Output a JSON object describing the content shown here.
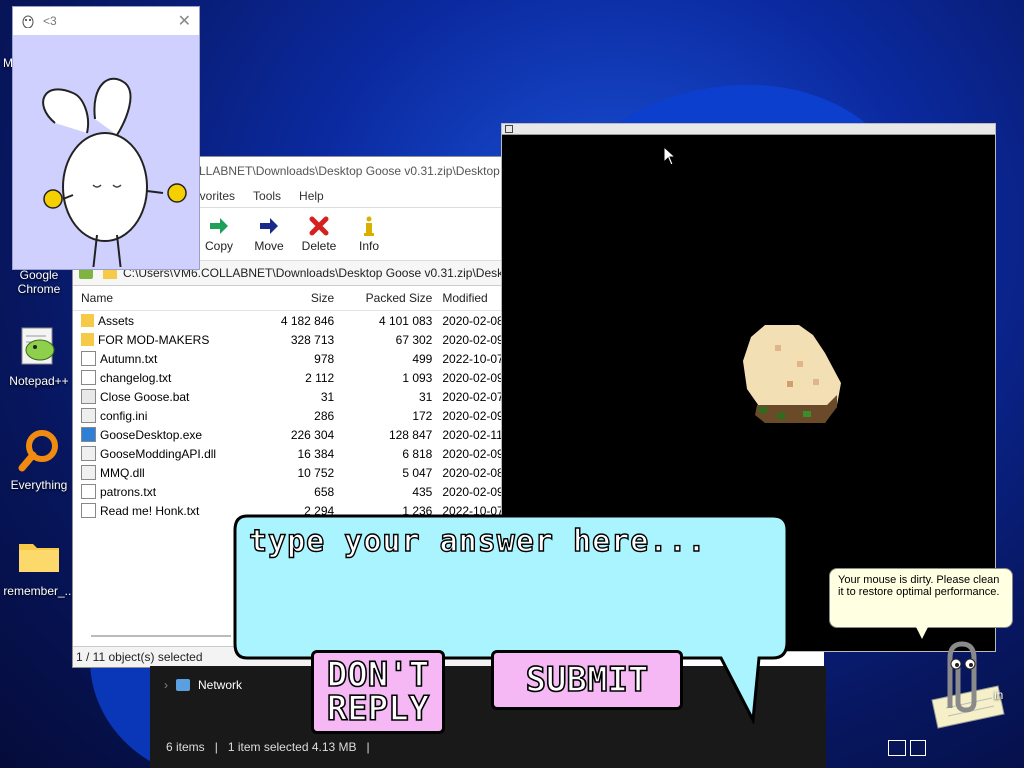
{
  "desktop": {
    "icons": [
      {
        "label": "M",
        "icon": "folder-icon"
      },
      {
        "label": "Google Chrome",
        "icon": "chrome-icon"
      },
      {
        "label": "Notepad++",
        "icon": "notepad-plus-plus-icon"
      },
      {
        "label": "Everything",
        "icon": "everything-search-icon"
      },
      {
        "label": "remember_...",
        "icon": "folder-icon"
      }
    ],
    "partial_label_right": "in"
  },
  "bunny_window": {
    "title": "<3",
    "image": "bunny-illustration"
  },
  "zip_window": {
    "title": "...LABNET\\Downloads\\Desktop Goose v0.31.zip\\Desktop Goose",
    "title_visible": "LLABNET\\Downloads\\Desktop Goose v0.31.zip\\Desktop G",
    "menu": [
      "avorites",
      "Tools",
      "Help"
    ],
    "toolbar": [
      {
        "label": "Copy",
        "icon": "copy-arrow-icon",
        "color": "#1fa05a"
      },
      {
        "label": "Move",
        "icon": "move-arrow-icon",
        "color": "#1a2a8a"
      },
      {
        "label": "Delete",
        "icon": "delete-x-icon",
        "color": "#d62020"
      },
      {
        "label": "Info",
        "icon": "info-icon",
        "color": "#d9b000"
      }
    ],
    "address": "C:\\Users\\VM6.COLLABNET\\Downloads\\Desktop Goose v0.31.zip\\Deskt",
    "columns": {
      "name": "Name",
      "size": "Size",
      "packed": "Packed Size",
      "modified": "Modified"
    },
    "files": [
      {
        "name": "Assets",
        "size": "4 182 846",
        "packed": "4 101 083",
        "modified": "2020-02-08",
        "type": "folder"
      },
      {
        "name": "FOR MOD-MAKERS",
        "size": "328 713",
        "packed": "67 302",
        "modified": "2020-02-09",
        "type": "folder"
      },
      {
        "name": "Autumn.txt",
        "size": "978",
        "packed": "499",
        "modified": "2022-10-07",
        "type": "text"
      },
      {
        "name": "changelog.txt",
        "size": "2 112",
        "packed": "1 093",
        "modified": "2020-02-09",
        "type": "text"
      },
      {
        "name": "Close Goose.bat",
        "size": "31",
        "packed": "31",
        "modified": "2020-02-07",
        "type": "bat"
      },
      {
        "name": "config.ini",
        "size": "286",
        "packed": "172",
        "modified": "2020-02-09",
        "type": "ini"
      },
      {
        "name": "GooseDesktop.exe",
        "size": "226 304",
        "packed": "128 847",
        "modified": "2020-02-11",
        "type": "exe"
      },
      {
        "name": "GooseModdingAPI.dll",
        "size": "16 384",
        "packed": "6 818",
        "modified": "2020-02-09",
        "type": "dll"
      },
      {
        "name": "MMQ.dll",
        "size": "10 752",
        "packed": "5 047",
        "modified": "2020-02-08",
        "type": "dll"
      },
      {
        "name": "patrons.txt",
        "size": "658",
        "packed": "435",
        "modified": "2020-02-09",
        "type": "text"
      },
      {
        "name": "Read me! Honk.txt",
        "size": "2 294",
        "packed": "1 236",
        "modified": "2022-10-07",
        "type": "text"
      }
    ],
    "status": "1 / 11 object(s) selected"
  },
  "explorer": {
    "nav_item": "Network",
    "status_items": "6 items",
    "status_selected": "1 item selected  4.13 MB",
    "separator": "|"
  },
  "game_window": {
    "sprite": "pixel-bread-loaf"
  },
  "dialog": {
    "prompt": "type your answer here...",
    "dont_reply": "DON'T REPLY",
    "dont_reply_line1": "DON'T",
    "dont_reply_line2": "REPLY",
    "submit": "SUBMIT",
    "bubble_color": "#aaf4ff",
    "button_color": "#f5b8f5"
  },
  "clippy": {
    "tip": "Your mouse is dirty. Please clean it to restore optimal performance."
  }
}
